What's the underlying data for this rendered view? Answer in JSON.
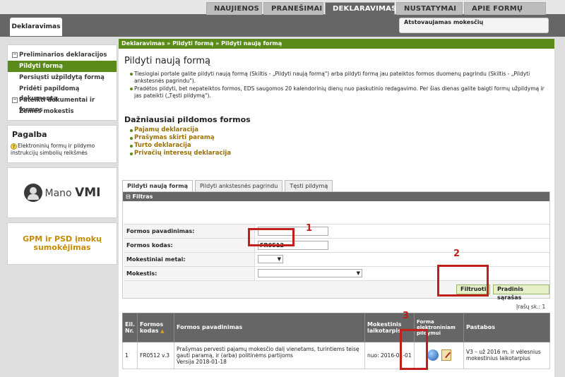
{
  "top_nav": {
    "items": [
      "NAUJIENOS",
      "PRANEŠIMAI",
      "DEKLARAVIMAS",
      "NUSTATYMAI",
      "APIE FORMŲ TEIKIMĄ"
    ],
    "active": "DEKLARAVIMAS"
  },
  "section_tab": "Deklaravimas",
  "representative_label": "Atstovaujamas mokesčių",
  "sidebar": {
    "menu": [
      {
        "label": "Preliminarios deklaracijos",
        "state": "section"
      },
      {
        "label": "Pildyti formą",
        "state": "active"
      },
      {
        "label": "Persiųsti užpildytą formą",
        "state": "normal"
      },
      {
        "label": "Pridėti papildomą dokumentą",
        "state": "normal"
      },
      {
        "label": "Pateikti dokumentai ir formos",
        "state": "section"
      },
      {
        "label": "Žemės mokestis",
        "state": "normal"
      }
    ],
    "help": {
      "title": "Pagalba",
      "text": "Elektroninių formų ir pildymo instrukcijų simbolių reikšmės"
    },
    "vmi": {
      "mano": "Mano",
      "vmi": "VMI"
    },
    "gpm": "GPM ir PSD įmokų sumokėjimas"
  },
  "breadcrumb": "Deklaravimas » Pildyti formą » Pildyti naują formą",
  "page": {
    "title": "Pildyti naują formą",
    "info": [
      "Tiesiogiai portale galite pildyti naują formą (Skiltis - „Pildyti naują formą\") arba pildyti formą jau pateiktos formos duomenų pagrindu (Skiltis - „Pildyti ankstesnės pagrindu\").",
      "Pradėtos pildyti, bet nepateiktos formos, EDS saugomos 20 kalendorinių dienų nuo paskutinio redagavimo. Per šias dienas galite baigti formų užpildymą ir jas pateikti („Tęsti pildymą\")."
    ],
    "frequent_title": "Dažniausiai pildomos formos",
    "frequent": [
      "Pajamų deklaracija",
      "Prašymas skirti paramą",
      "Turto deklaracija",
      "Privačių interesų deklaracija"
    ]
  },
  "tabs": [
    "Pildyti naują formą",
    "Pildyti ankstesnės pagrindu",
    "Tęsti pildymą"
  ],
  "filter": {
    "header": "Filtras",
    "fields": {
      "name_label": "Formos pavadinimas:",
      "name_value": "",
      "code_label": "Formos kodas:",
      "code_value": "FR0512",
      "year_label": "Mokestiniai metai:",
      "tax_label": "Mokestis:"
    },
    "filter_button": "Filtruoti",
    "reset_button": "Pradinis sąrašas"
  },
  "records": "Įrašų sk.: 1",
  "table": {
    "headers": [
      "Eil. Nr.",
      "Formos kodas",
      "Formos pavadinimas",
      "Mokestinis laikotarpis",
      "Forma elektroniniam pildymui",
      "Pastabos"
    ],
    "rows": [
      {
        "no": "1",
        "code": "FR0512 v.3",
        "name": "Prašymas pervesti pajamų mokesčio dalį vienetams, turintiems teisę gauti paramą, ir (arba) politinėms partijoms",
        "version": "Versija 2018-01-18",
        "period": "nuo: 2016-01-01",
        "note": "V3 – už 2016 m. ir vėlesnius mokestinius laikotarpius"
      }
    ]
  },
  "annotations": [
    "1",
    "2",
    "3"
  ],
  "colors": {
    "green": "#5a8a1a",
    "dark_gray": "#666666",
    "gold": "#c48a00",
    "annotation_red": "#c0201c"
  }
}
